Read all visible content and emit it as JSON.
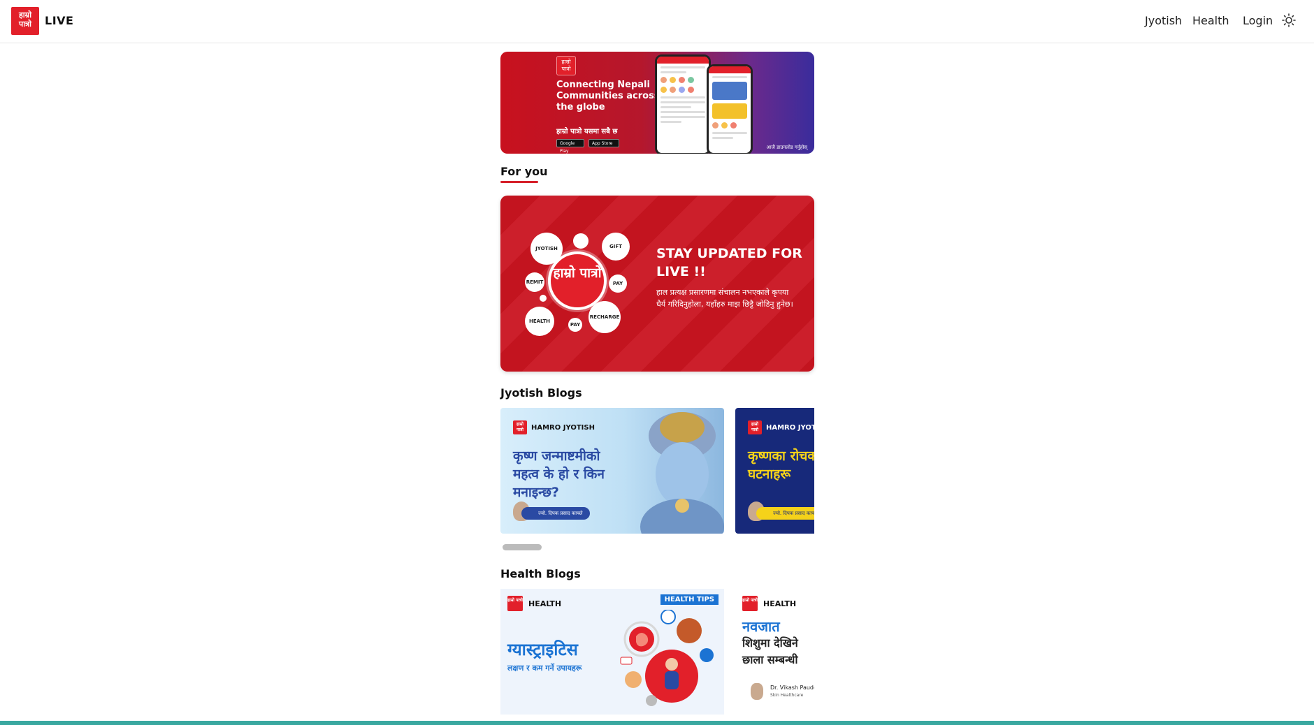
{
  "header": {
    "logo_text": "हाम्रो पात्रो",
    "live_label": "LIVE",
    "nav": {
      "jyotish": "Jyotish",
      "health": "Health",
      "login": "Login"
    },
    "theme_icon": "sun-icon"
  },
  "banner": {
    "logo_text": "हाम्रो पात्रो",
    "headline": "Connecting Nepali Communities across the globe",
    "subline": "हाम्रो पात्रो यसमा सबै छ",
    "google_play": "Google Play",
    "app_store": "App Store",
    "corner_text": "आजै डाउनलोड गर्नुहोस्"
  },
  "for_you": {
    "title": "For you"
  },
  "promo": {
    "logo_text": "हाम्रो पात्रो",
    "bubbles": [
      "JYOTISH",
      "GIFT",
      "REMIT",
      "PAY",
      "HEALTH",
      "PAY",
      "RECHARGE"
    ],
    "title": "STAY UPDATED FOR LIVE !!",
    "description": "हाल प्रत्यक्ष प्रसारणमा संचालन नभएकाले कृपया धैर्य गरिदिनुहोला, यहाँहरु माझ छिट्टै जोडिनु हुनेछ।"
  },
  "jyotish_blogs": {
    "title": "Jyotish Blogs",
    "cards": [
      {
        "brand": "HAMRO JYOTISH",
        "logo_text": "हाम्रो पात्रो",
        "headline": "कृष्ण जन्माष्टमीको महत्व के हो र किन मनाइन्छ?",
        "author": "ज्यो. दिपक प्रसाद काफ्ले"
      },
      {
        "brand": "HAMRO JYOTISH",
        "logo_text": "हाम्रो पात्रो",
        "headline": "कृष्णका रोचक घटनाहरू",
        "author": "ज्यो. दिपक प्रसाद काफ्ले"
      }
    ]
  },
  "health_blogs": {
    "title": "Health Blogs",
    "cards": [
      {
        "brand": "HEALTH",
        "logo_text": "हाम्रो पात्रो",
        "tag": "HEALTH TIPS",
        "headline": "ग्यास्ट्राइटिस",
        "subheadline": "लक्षण र कम गर्ने उपायहरू"
      },
      {
        "brand": "HEALTH",
        "logo_text": "हाम्रो पात्रो",
        "headline_1": "नवजात",
        "headline_2": "शिशुमा देखिने",
        "headline_3": "छाला सम्बन्धी",
        "doctor_name": "Dr. Vikash Paudel",
        "doctor_role": "Skin Healthcare"
      }
    ]
  },
  "colors": {
    "brand_red": "#e2202a",
    "accent_blue": "#1b73d3",
    "jyotish_yellow": "#f5d21a"
  }
}
